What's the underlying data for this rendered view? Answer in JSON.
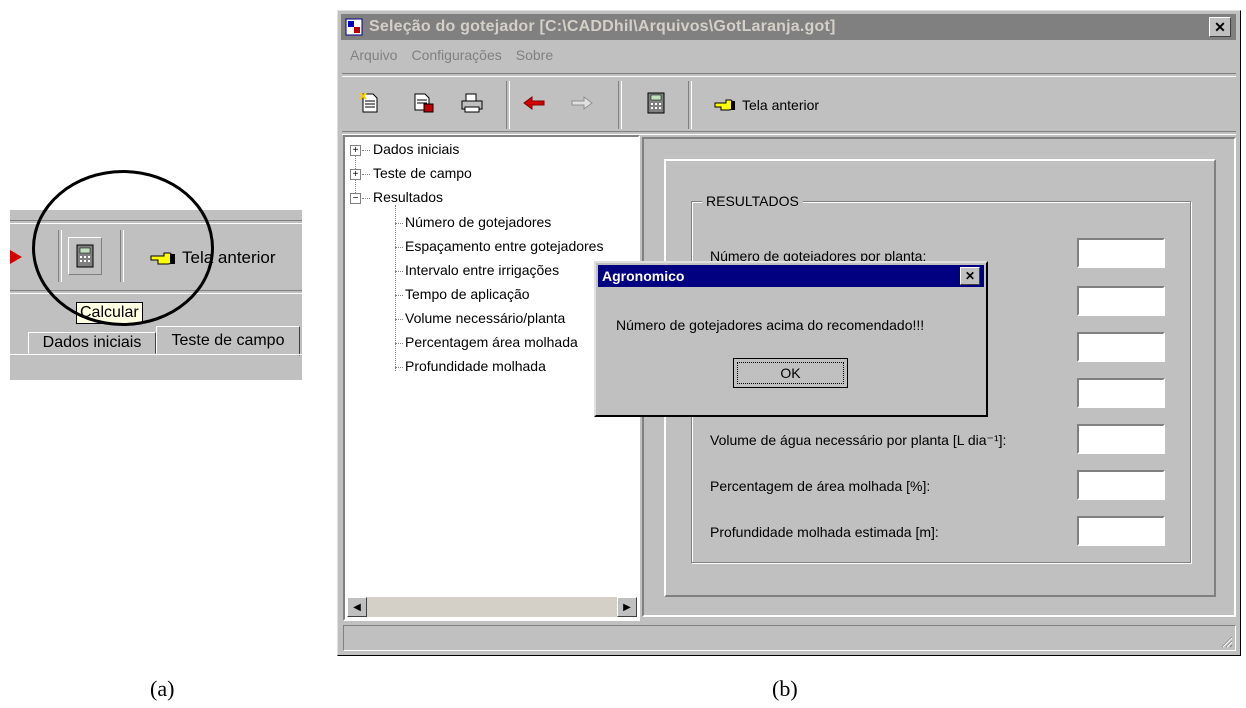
{
  "panel_a": {
    "tela_label": "Tela anterior",
    "tooltip": "Calcular",
    "tab_dados": "Dados iniciais",
    "tab_teste": "Teste de campo",
    "caption": "(a)"
  },
  "window": {
    "title": "Seleção do gotejador [C:\\CADDhil\\Arquivos\\GotLaranja.got]",
    "close_symbol": "✕",
    "menu": {
      "arquivo": "Arquivo",
      "configuracoes": "Configurações",
      "sobre": "Sobre"
    },
    "toolbar": {
      "tela_anterior": "Tela anterior"
    },
    "tree": {
      "dados_iniciais": "Dados iniciais",
      "teste_de_campo": "Teste de campo",
      "resultados": "Resultados",
      "children": [
        "Número de gotejadores",
        "Espaçamento entre gotejadores",
        "Intervalo entre irrigações",
        "Tempo de aplicação",
        "Volume necessário/planta",
        "Percentagem área molhada",
        "Profundidade molhada"
      ],
      "plus": "+",
      "minus": "−"
    },
    "results": {
      "group_title": "RESULTADOS",
      "fields": [
        {
          "label": "Número de gotejadores por planta:",
          "value": ""
        },
        {
          "label": "",
          "value": ""
        },
        {
          "label": "",
          "value": ""
        },
        {
          "label": "",
          "value": ""
        },
        {
          "label": "Volume de água necessário por planta [L dia⁻¹]:",
          "value": ""
        },
        {
          "label": "Percentagem de área molhada [%]:",
          "value": ""
        },
        {
          "label": "Profundidade molhada estimada [m]:",
          "value": ""
        }
      ]
    },
    "dialog": {
      "title": "Agronomico",
      "message": "Número de gotejadores acima do recomendado!!!",
      "ok": "OK",
      "close_symbol": "✕"
    },
    "scroll_left": "◀",
    "scroll_right": "▶"
  },
  "caption_b": "(b)",
  "icons": [
    "new-file-icon",
    "save-file-icon",
    "print-icon",
    "back-arrow-icon",
    "forward-arrow-icon",
    "calculator-icon",
    "pointing-hand-icon",
    "app-icon"
  ],
  "colors": {
    "face": "#c0c0c0",
    "titlebar_inactive": "#808080",
    "titlebar_active": "#000080",
    "tooltip": "#ffffe1"
  }
}
